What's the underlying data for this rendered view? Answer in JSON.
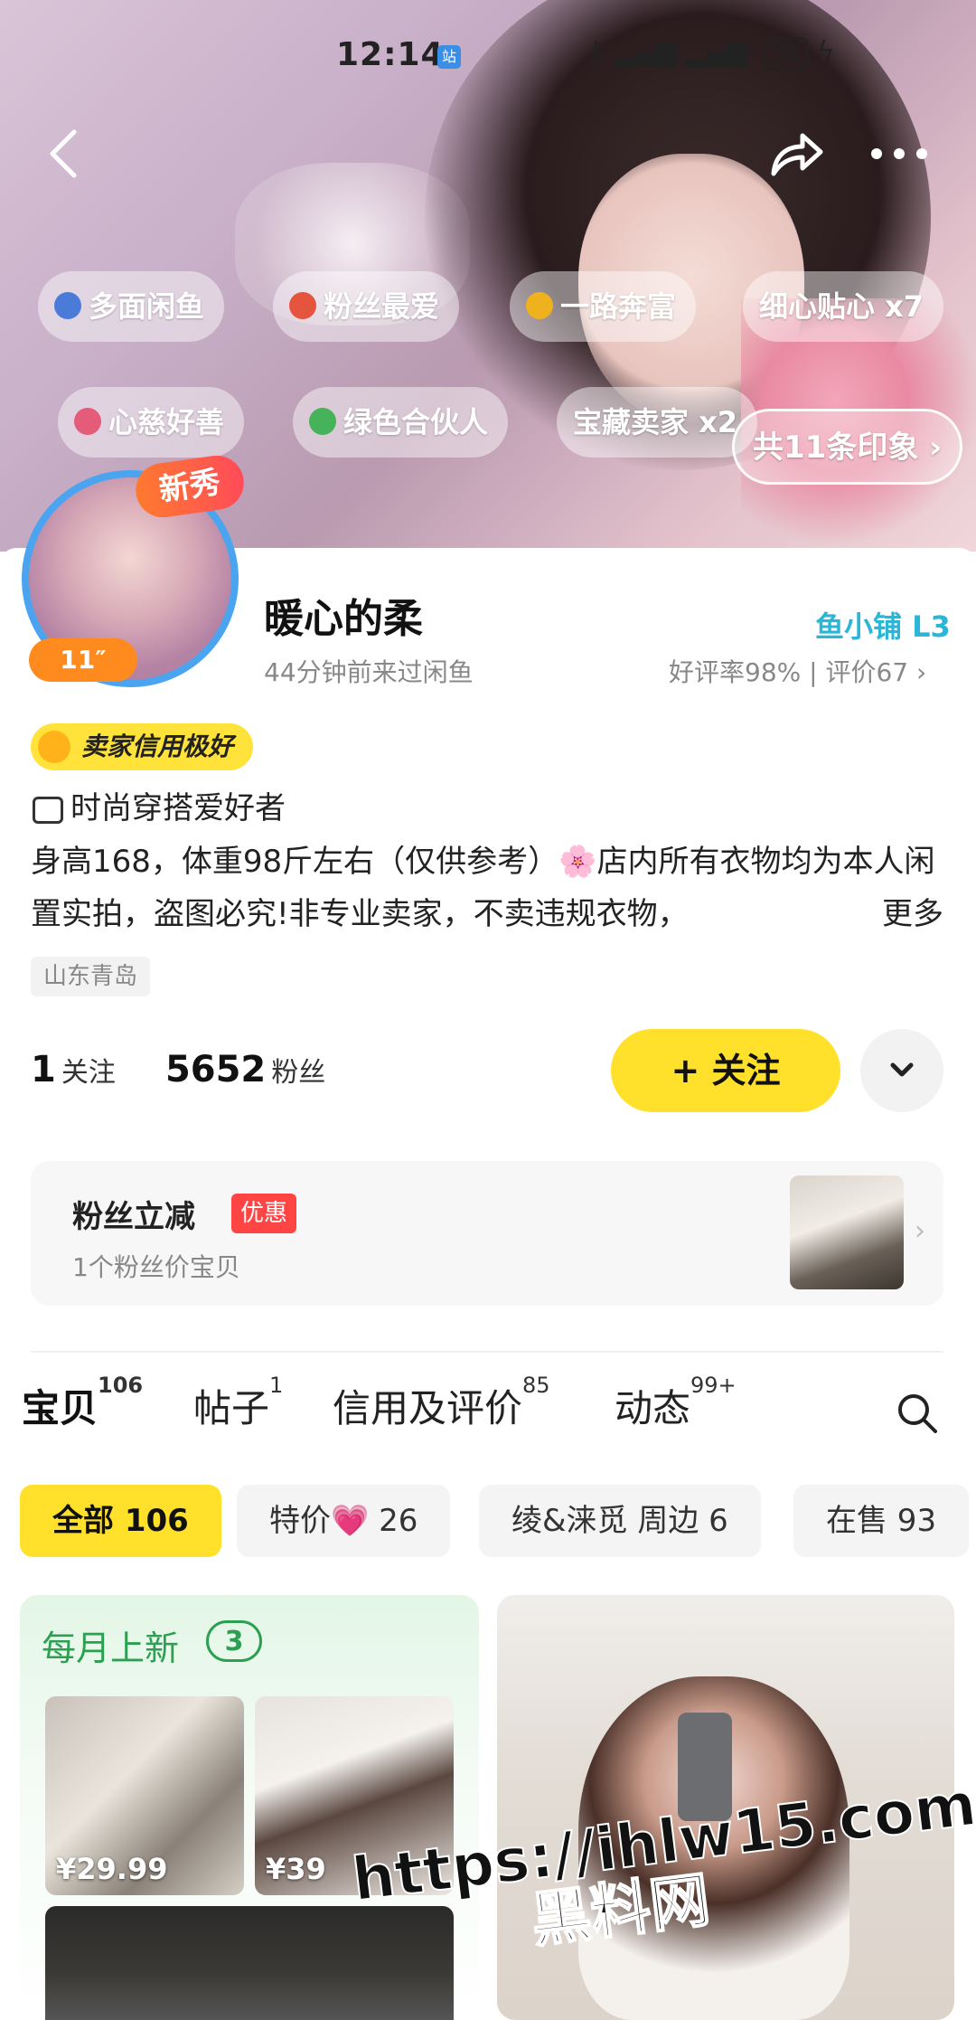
{
  "status_bar": {
    "time": "12:14",
    "app_badge": "站",
    "icons": [
      "key-icon",
      "signal-icon",
      "wifi-icon",
      "bluetooth-icon"
    ],
    "battery": "39"
  },
  "hero": {
    "tags": [
      {
        "label": "多面闲鱼",
        "icon_color": "#4b7bd8"
      },
      {
        "label": "粉丝最爱",
        "icon_color": "#e5543c"
      },
      {
        "label": "一路奔富",
        "icon_color": "#f0b21c"
      },
      {
        "label": "细心贴心 x7",
        "icon_color": ""
      },
      {
        "label": "心慈好善",
        "icon_color": "#e55c7a"
      },
      {
        "label": "绿色合伙人",
        "icon_color": "#46b25a"
      },
      {
        "label": "宝藏卖家 x2",
        "icon_color": ""
      }
    ],
    "impressions_label": "共11条印象 ›"
  },
  "profile": {
    "new_badge": "新秀",
    "time_badge": "11″",
    "name": "暖心的柔",
    "last_seen": "44分钟前来过闲鱼",
    "shop_level": "鱼小铺 L3",
    "rating": "好评率98% | 评价67 ›",
    "credit_badge": "卖家信用极好",
    "hobby": "时尚穿搭爱好者",
    "bio": "身高168，体重98斤左右（仅供参考）🌸店内所有衣物均为本人闲置实拍，盗图必究!非专业卖家，不卖违规衣物，",
    "bio_more": "更多",
    "location": "山东青岛",
    "following_count": "1",
    "following_label": "关注",
    "fans_count": "5652",
    "fans_label": "粉丝",
    "follow_button": "+ 关注"
  },
  "fan_deal": {
    "title": "粉丝立减",
    "badge": "优惠",
    "subtitle": "1个粉丝价宝贝"
  },
  "tabs": [
    {
      "label": "宝贝",
      "count": "106"
    },
    {
      "label": "帖子",
      "count": "1"
    },
    {
      "label": "信用及评价",
      "count": "85"
    },
    {
      "label": "动态",
      "count": "99+"
    }
  ],
  "chips": [
    {
      "label": "全部 106"
    },
    {
      "label": "特价💗 26"
    },
    {
      "label": "绫&涞觅 周边 6"
    },
    {
      "label": "在售 93"
    }
  ],
  "monthly": {
    "title": "每月上新",
    "count": "3",
    "prices": [
      "¥29.99",
      "¥39"
    ]
  },
  "watermark": {
    "line1": "https://ihlw15.com",
    "line2": "黑料网"
  },
  "colors": {
    "accent_yellow": "#ffe12b",
    "shop_blue": "#2bb6d8",
    "monthly_green": "#2c9f52",
    "badge_red": "#ff4444"
  }
}
